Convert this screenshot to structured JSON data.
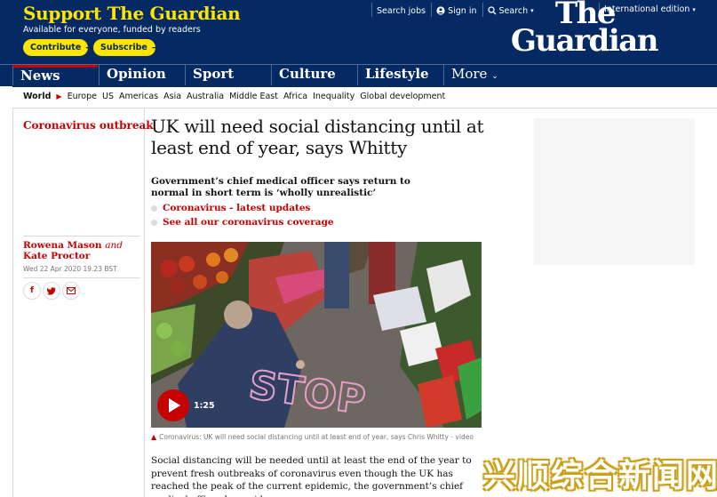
{
  "header": {
    "support_title": "Support The Guardian",
    "support_sub": "Available for everyone, funded by readers",
    "contribute_label": "Contribute",
    "subscribe_label": "Subscribe",
    "search_jobs": "Search jobs",
    "sign_in": "Sign in",
    "search": "Search",
    "edition": "International edition",
    "logo_line1": "The",
    "logo_line2": "Guardian"
  },
  "nav": {
    "pillars": [
      "News",
      "Opinion",
      "Sport",
      "Culture",
      "Lifestyle"
    ],
    "more": "More"
  },
  "subnav": {
    "current": "World",
    "items": [
      "Europe",
      "US",
      "Americas",
      "Asia",
      "Australia",
      "Middle East",
      "Africa",
      "Inequality",
      "Global development"
    ]
  },
  "article": {
    "kicker": "Coronavirus outbreak",
    "headline": "UK will need social distancing until at least end of year, says Whitty",
    "standfirst": "Government’s chief medical officer says return to normal in short term is ‘wholly unrealistic’",
    "related": [
      "Coronavirus - latest updates",
      "See all our coronavirus coverage"
    ],
    "byline_author1": "Rowena Mason",
    "byline_and": "and",
    "byline_author2": "Kate Proctor",
    "dateline": "Wed 22 Apr 2020 19.23 BST",
    "share": [
      "f",
      "t",
      "email"
    ],
    "video_duration": "1:25",
    "video_caption": "Coronavirus: UK will need social distancing until at least end of year, says Chris Whitty - video",
    "body": "Social distancing will be needed until at least the end of the year to prevent fresh outbreaks of coronavirus even though the UK has reached the peak of the current epidemic, the government’s chief medical officer has said.",
    "chalk_text": "STOP"
  },
  "watermark": "兴顺综合新闻网",
  "colors": {
    "brand_blue": "#052962",
    "support_yellow": "#ffe500",
    "news_red": "#c70000"
  }
}
